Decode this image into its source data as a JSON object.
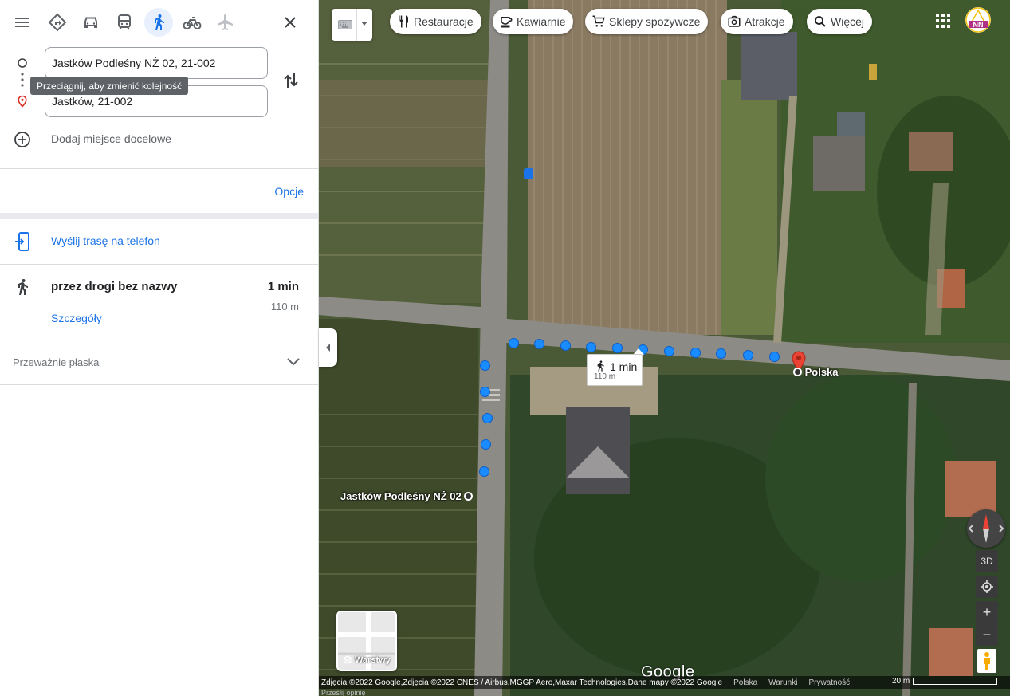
{
  "panel": {
    "mode_icons": [
      "menu-icon",
      "best-route-icon",
      "car-icon",
      "transit-icon",
      "walking-icon",
      "bicycle-icon",
      "plane-icon",
      "close-icon"
    ],
    "origin_value": "Jastków Podleśny NŻ 02, 21-002",
    "destination_value": "Jastków, 21-002",
    "drag_tooltip": "Przeciągnij, aby zmienić kolejność",
    "add_destination": "Dodaj miejsce docelowe",
    "options_link": "Opcje",
    "send_to_phone": "Wyślij trasę na telefon",
    "route": {
      "title": "przez drogi bez nazwy",
      "time": "1 min",
      "distance": "110 m",
      "details_link": "Szczegóły"
    },
    "terrain": "Przeważnie płaska"
  },
  "map": {
    "chips": [
      "Restauracje",
      "Kawiarnie",
      "Sklepy spożywcze",
      "Atrakcje",
      "Więcej"
    ],
    "callout_time": "1 min",
    "callout_distance": "110 m",
    "label_destination": "Polska",
    "label_origin": "Jastków Podleśny NŻ 02",
    "avatar_text": "NN",
    "layers_label": "Warstwy",
    "btn_3d": "3D",
    "zoom_in": "+",
    "zoom_out": "−",
    "google_logo": "Google",
    "attribution": "Zdjęcia ©2022 Google,Zdjęcia ©2022 CNES / Airbus,MGGP Aero,Maxar Technologies,Dane mapy ©2022 Google",
    "footer_links": [
      "Polska",
      "Warunki",
      "Prywatność"
    ],
    "feedback": "Prześlij opinię",
    "scale": "20 m"
  },
  "colors": {
    "accent_blue": "#1a73e8",
    "route_dot": "#1a8cff",
    "active_mode_bg": "#e8f0fe",
    "pin_red": "#ea4335"
  }
}
